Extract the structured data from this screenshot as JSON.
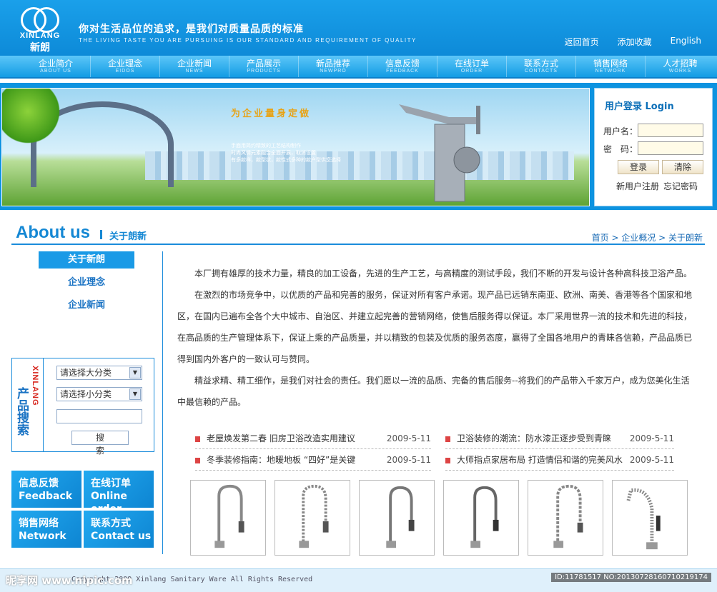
{
  "header": {
    "logo_en": "XINLANG",
    "logo_cn": "新朗",
    "slogan": "你对生活品位的追求，是我们对质量品质的标准",
    "slogan_en": "THE LIVING TASTE YOU ARE PURSUING IS OUR STANDARD AND REQUIREMENT OF QUALITY",
    "links": [
      "返回首页",
      "添加收藏",
      "English"
    ]
  },
  "nav": [
    {
      "cn": "企业简介",
      "en": "ABOUT US"
    },
    {
      "cn": "企业理念",
      "en": "EIDOS"
    },
    {
      "cn": "企业新闻",
      "en": "NEWS"
    },
    {
      "cn": "产品展示",
      "en": "PRODUCTS"
    },
    {
      "cn": "新品推荐",
      "en": "NEWPRO"
    },
    {
      "cn": "信息反馈",
      "en": "FEEDBACK"
    },
    {
      "cn": "在线订单",
      "en": "ORDER"
    },
    {
      "cn": "联系方式",
      "en": "CONTACTS"
    },
    {
      "cn": "销售网络",
      "en": "NETWORK"
    },
    {
      "cn": "人才招聘",
      "en": "WORKS"
    }
  ],
  "banner": {
    "title": "为企业量身定做",
    "line1": "手面用简约精致的工艺结构制作",
    "line2": "时尚风情元素融合全面开展，取消设置",
    "line3": "有多款样，款型状，款性式多种的款户型供您选择"
  },
  "login": {
    "title": "用户登录 Login",
    "user_label": "用户名：",
    "pass_label": "密　码：",
    "login_btn": "登录",
    "clear_btn": "清除",
    "register": "新用户注册",
    "forgot": "忘记密码"
  },
  "about": {
    "title_en": "About us",
    "title_cn": "关于朗新",
    "breadcrumb": "首页 > 企业概况 > 关于朗新"
  },
  "left_menu": [
    "关于新朗",
    "企业理念",
    "企业新闻"
  ],
  "search": {
    "side_en": "XINLANG",
    "side_cn": "产品搜索",
    "cat1": "请选择大分类",
    "cat2": "请选择小分类",
    "button": "搜　索"
  },
  "quick_links": [
    {
      "cn": "信息反馈",
      "en": "Feedback"
    },
    {
      "cn": "在线订单",
      "en": "Online order"
    },
    {
      "cn": "销售网络",
      "en": "Network"
    },
    {
      "cn": "联系方式",
      "en": "Contact us"
    }
  ],
  "content": {
    "p1": "本厂拥有雄厚的技术力量，精良的加工设备，先进的生产工艺，与高精度的测试手段，我们不断的开发与设计各种高科技卫浴产品。",
    "p2": "在激烈的市场竞争中，以优质的产品和完善的服务，保证对所有客户承诺。现产品已远销东南亚、欧洲、南美、香港等各个国家和地区，在国内已遍布全各个大中城市、自治区、并建立起完善的营销网络，使售后服务得以保证。本厂采用世界一流的技术和先进的科技，在高品质的生产管理体系下，保证上乘的产品质量，并以精致的包装及优质的服务态度，赢得了全国各地用户的青睐各信赖，产品品质已得到国内外客户的一致认可与赞同。",
    "p3": "精益求精、精工细作，是我们对社会的责任。我们愿以一流的品质、完备的售后服务--将我们的产品带入千家万户，成为您美化生活中最信赖的产品。"
  },
  "news": [
    {
      "title": "老屋焕发第二春 旧房卫浴改造实用建议",
      "date": "2009-5-11"
    },
    {
      "title": "卫浴装修的潮流：防水漆正逐步受到青睐",
      "date": "2009-5-11"
    },
    {
      "title": "冬季装修指南：地暖地板 “四好”是关键",
      "date": "2009-5-11"
    },
    {
      "title": "大师指点家居布局 打造情侣和谐的完美风水",
      "date": "2009-5-11"
    }
  ],
  "footer": {
    "copyright": "Copyright 2009 Xinlang Sanitary Ware All Rights Reserved",
    "watermark": "昵享网 www.nipic.com",
    "id": "ID:11781517 NO:20130728160710219174"
  }
}
